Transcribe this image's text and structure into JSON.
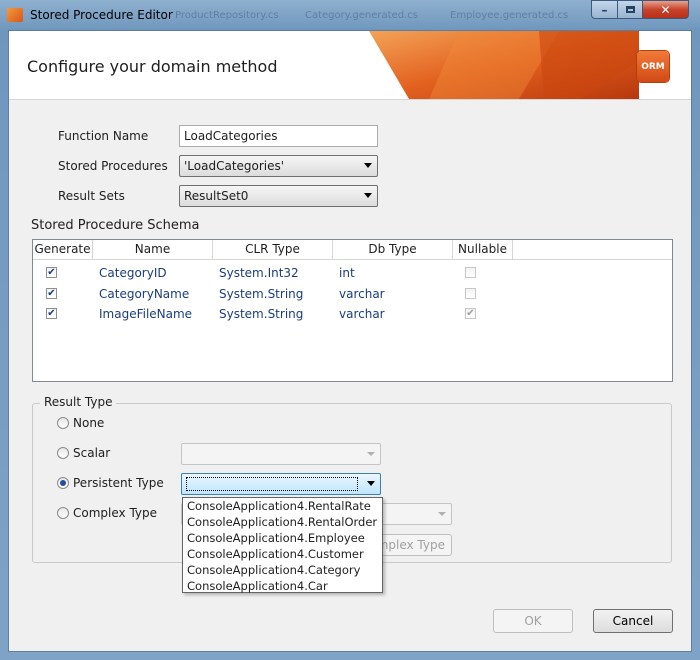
{
  "window": {
    "title": "Stored Procedure Editor",
    "bg_tabs": [
      "ProductRepository.cs",
      "Category.generated.cs",
      "Employee.generated.cs"
    ]
  },
  "header": {
    "title": "Configure your domain method",
    "logo_text": "ORM"
  },
  "form": {
    "function_name_label": "Function Name",
    "function_name_value": "LoadCategories",
    "stored_procedures_label": "Stored Procedures",
    "stored_procedures_value": "'LoadCategories'",
    "result_sets_label": "Result Sets",
    "result_sets_value": "ResultSet0"
  },
  "schema": {
    "title": "Stored Procedure Schema",
    "columns": [
      "Generate",
      "Name",
      "CLR Type",
      "Db Type",
      "Nullable"
    ],
    "rows": [
      {
        "generate": true,
        "name": "CategoryID",
        "clr_type": "System.Int32",
        "db_type": "int",
        "nullable": false
      },
      {
        "generate": true,
        "name": "CategoryName",
        "clr_type": "System.String",
        "db_type": "varchar",
        "nullable": false
      },
      {
        "generate": true,
        "name": "ImageFileName",
        "clr_type": "System.String",
        "db_type": "varchar",
        "nullable": true
      }
    ]
  },
  "result_type": {
    "title": "Result Type",
    "options": [
      "None",
      "Scalar",
      "Persistent Type",
      "Complex Type"
    ],
    "selected": "Persistent Type",
    "create_complex_type_partial": "mplex Type",
    "dropdown_items": [
      "ConsoleApplication4.RentalRate",
      "ConsoleApplication4.RentalOrder",
      "ConsoleApplication4.Employee",
      "ConsoleApplication4.Customer",
      "ConsoleApplication4.Category",
      "ConsoleApplication4.Car"
    ]
  },
  "buttons": {
    "ok": "OK",
    "cancel": "Cancel"
  },
  "colors": {
    "accent_orange": "#e2601e",
    "link_blue": "#1a3d7c"
  }
}
